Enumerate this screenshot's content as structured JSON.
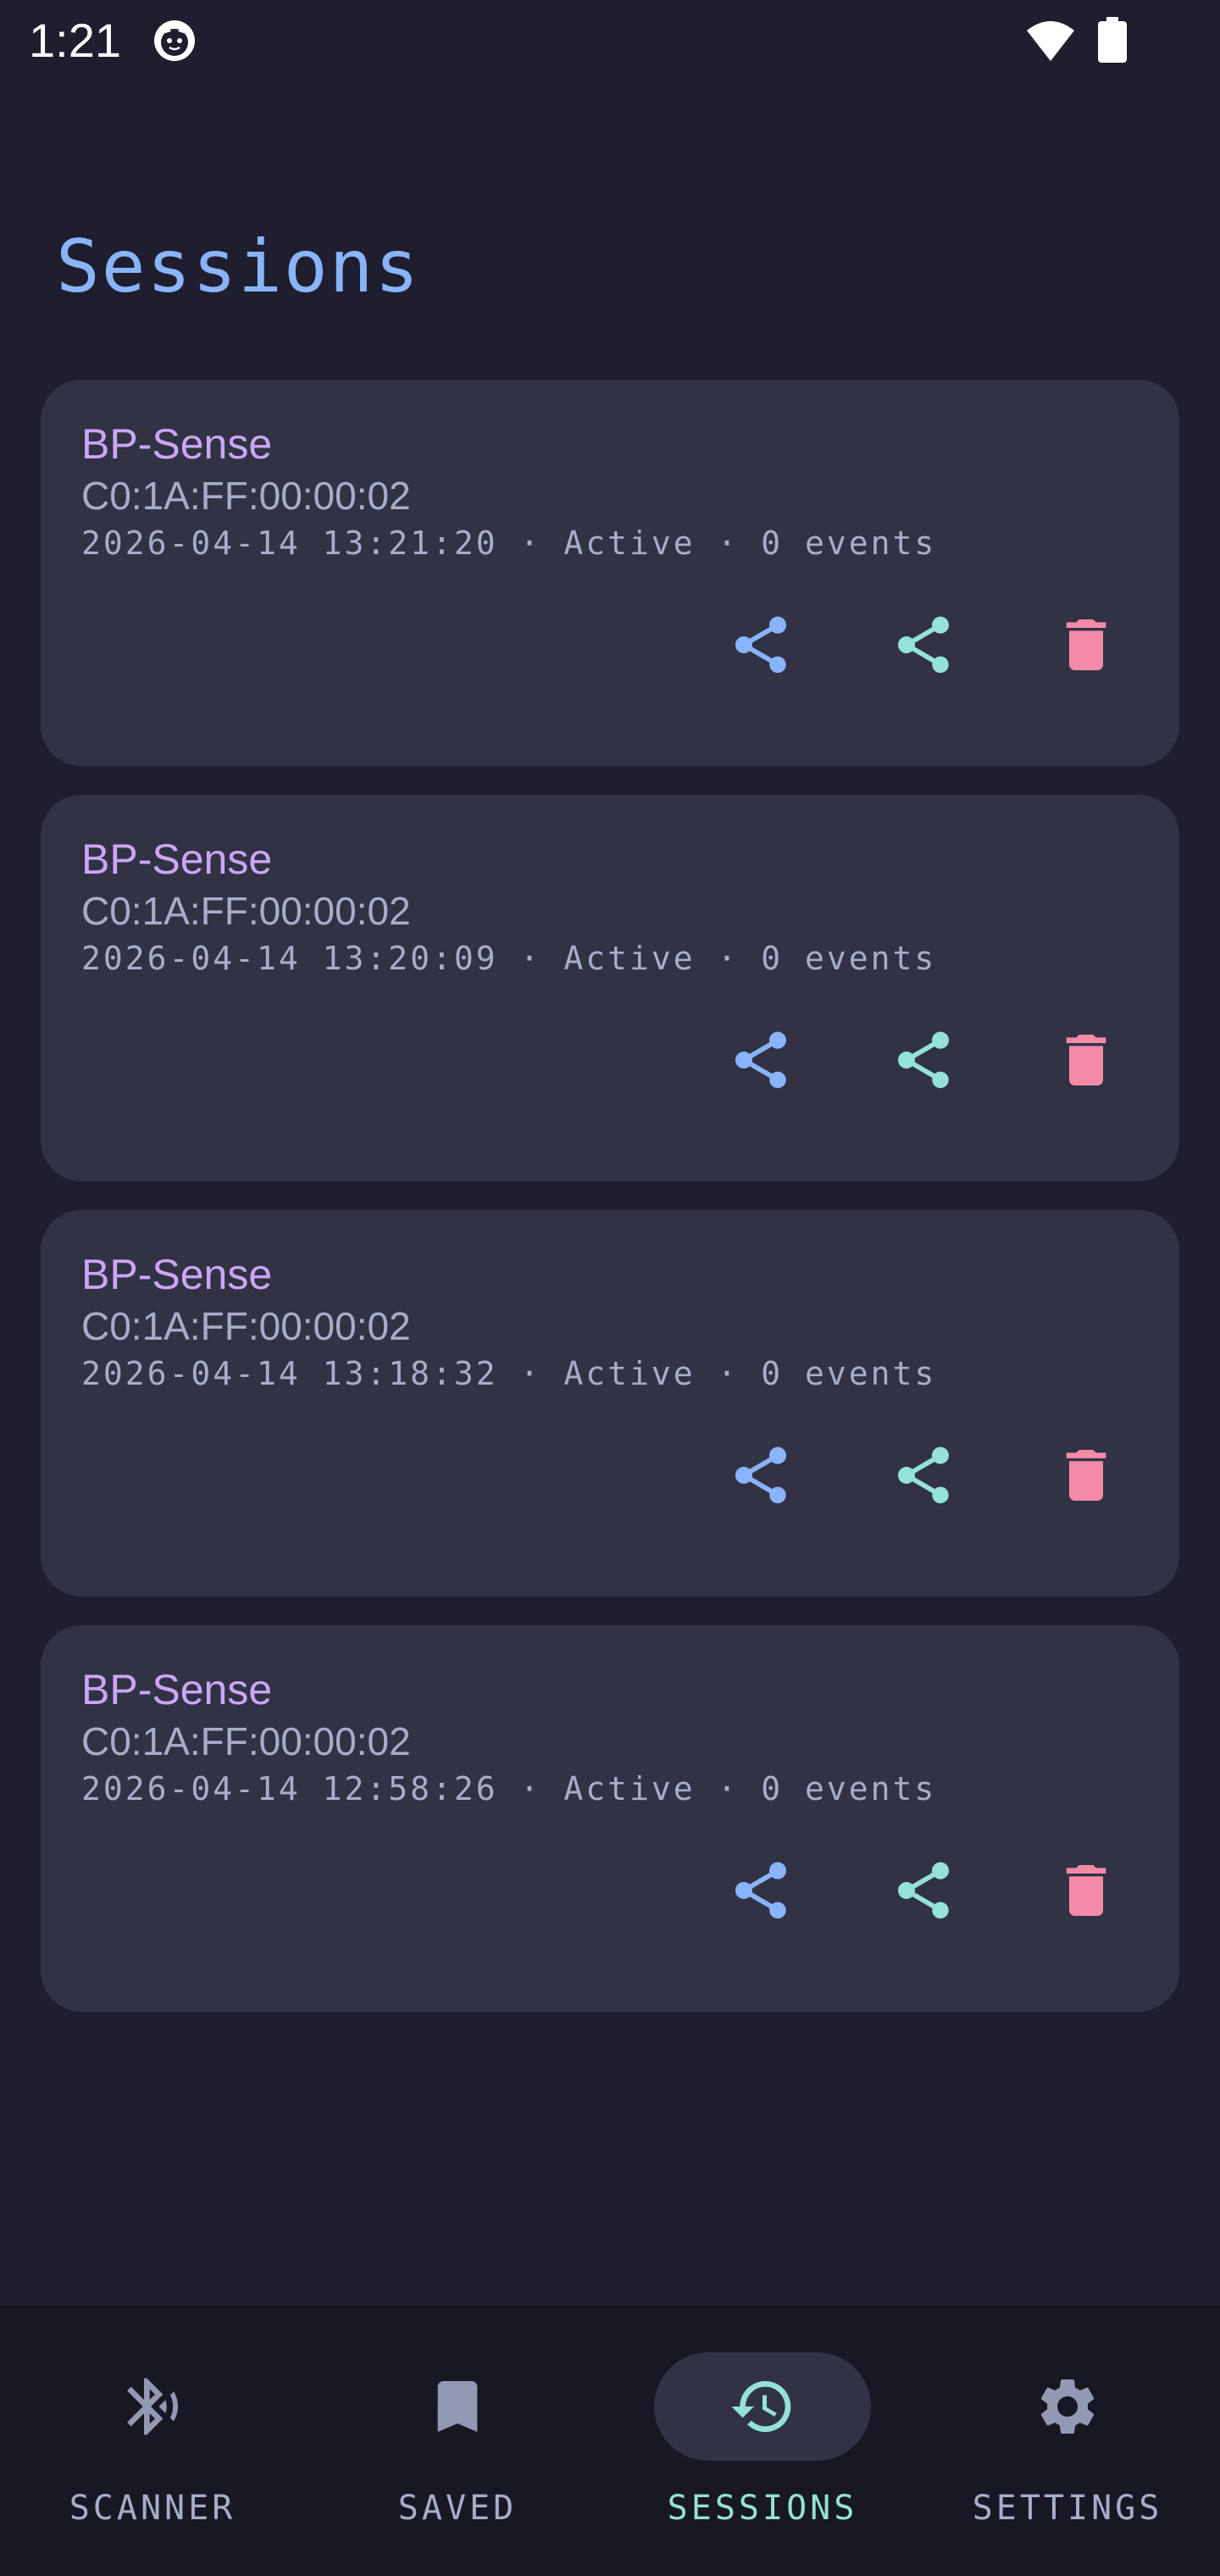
{
  "status_bar": {
    "time": "1:21",
    "icons": [
      "notification-icon",
      "wifi-icon",
      "battery-icon"
    ]
  },
  "page": {
    "title": "Sessions"
  },
  "colors": {
    "background": "#1e1e2e",
    "card": "#313244",
    "title": "#89b4fa",
    "device": "#cba6f7",
    "export_icon": "#89b4fa",
    "share_icon": "#94e2d5",
    "delete_icon": "#f38ba8",
    "active_nav": "#94e2d5"
  },
  "sessions": [
    {
      "device": "BP-Sense",
      "mac": "C0:1A:FF:00:00:02",
      "meta": "2026-04-14 13:21:20 · Active · 0 events",
      "actions": [
        "export-icon",
        "share-icon",
        "delete-icon"
      ]
    },
    {
      "device": "BP-Sense",
      "mac": "C0:1A:FF:00:00:02",
      "meta": "2026-04-14 13:20:09 · Active · 0 events",
      "actions": [
        "export-icon",
        "share-icon",
        "delete-icon"
      ]
    },
    {
      "device": "BP-Sense",
      "mac": "C0:1A:FF:00:00:02",
      "meta": "2026-04-14 13:18:32 · Active · 0 events",
      "actions": [
        "export-icon",
        "share-icon",
        "delete-icon"
      ]
    },
    {
      "device": "BP-Sense",
      "mac": "C0:1A:FF:00:00:02",
      "meta": "2026-04-14 12:58:26 · Active · 0 events",
      "actions": [
        "export-icon",
        "share-icon",
        "delete-icon"
      ]
    }
  ],
  "nav": {
    "items": [
      {
        "label": "SCANNER",
        "icon": "bluetooth-searching-icon",
        "active": false
      },
      {
        "label": "SAVED",
        "icon": "bookmark-icon",
        "active": false
      },
      {
        "label": "SESSIONS",
        "icon": "history-icon",
        "active": true
      },
      {
        "label": "SETTINGS",
        "icon": "gear-icon",
        "active": false
      }
    ]
  }
}
